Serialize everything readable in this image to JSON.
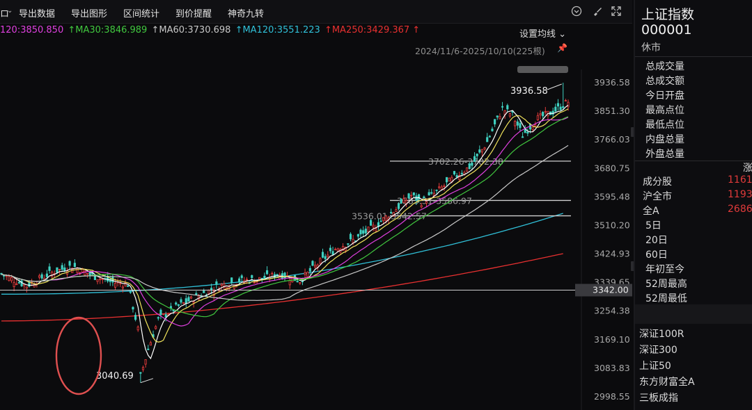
{
  "toolbar": {
    "first_item": "ロ",
    "items": [
      "导出数据",
      "导出图形",
      "区间统计",
      "到价提醒",
      "神奇九转"
    ],
    "icons": [
      "chevron-circle-icon",
      "brush-icon",
      "fullscreen-icon"
    ]
  },
  "ma_bar": {
    "ma20": "120:3850.850",
    "ma30": "↑MA30:3846.989",
    "ma60": "↑MA60:3730.698",
    "ma120": "↑MA120:3551.223",
    "ma250": "↑MA250:3429.367 ↑"
  },
  "colors": {
    "ma5": "#ffffff",
    "ma10": "#f2e55c",
    "ma20": "#e040e0",
    "ma30": "#41c83f",
    "ma60": "#c8c8c8",
    "ma120": "#30c0d8",
    "ma250": "#e83030",
    "up": "#e03a3a",
    "down": "#3fd0c0"
  },
  "setting_label": "设置均线",
  "range_label": "2024/11/6-2025/10/10(225根)",
  "chart_data": {
    "type": "candlestick",
    "y_axis_ticks": [
      "3936.58",
      "3851.30",
      "3766.03",
      "3680.75",
      "3595.48",
      "3510.20",
      "3424.93",
      "3339.65",
      "3254.38",
      "3169.10",
      "3083.83",
      "2998.55"
    ],
    "ylim": [
      2998.55,
      3936.58
    ],
    "current_price_tag": "3342.00",
    "high_label": "3936.58",
    "low_label": "3040.69",
    "gap_labels": [
      "3702.26-3702.38",
      "3583.31-3586.97",
      "3536.01-3542.57"
    ],
    "gap_levels": [
      3702.3,
      3585.0,
      3539.0
    ],
    "candle_count": 225,
    "series": [
      {
        "name": "MA20",
        "color_key": "ma20"
      },
      {
        "name": "MA30",
        "color_key": "ma30"
      },
      {
        "name": "MA60",
        "color_key": "ma60"
      },
      {
        "name": "MA120",
        "color_key": "ma120"
      },
      {
        "name": "MA250",
        "color_key": "ma250"
      }
    ],
    "close_path": [
      [
        0,
        3365
      ],
      [
        10,
        3330
      ],
      [
        20,
        3370
      ],
      [
        28,
        3390
      ],
      [
        36,
        3360
      ],
      [
        44,
        3340
      ],
      [
        50,
        3335
      ],
      [
        54,
        3200
      ],
      [
        55,
        3060
      ],
      [
        58,
        3140
      ],
      [
        62,
        3230
      ],
      [
        70,
        3270
      ],
      [
        78,
        3300
      ],
      [
        86,
        3330
      ],
      [
        94,
        3345
      ],
      [
        102,
        3350
      ],
      [
        110,
        3365
      ],
      [
        118,
        3345
      ],
      [
        125,
        3395
      ],
      [
        132,
        3440
      ],
      [
        140,
        3470
      ],
      [
        148,
        3510
      ],
      [
        156,
        3560
      ],
      [
        162,
        3600
      ],
      [
        166,
        3580
      ],
      [
        172,
        3610
      ],
      [
        180,
        3660
      ],
      [
        186,
        3690
      ],
      [
        192,
        3760
      ],
      [
        198,
        3860
      ],
      [
        202,
        3840
      ],
      [
        206,
        3780
      ],
      [
        212,
        3830
      ],
      [
        218,
        3850
      ],
      [
        224,
        3880
      ]
    ]
  },
  "panel": {
    "name": "上证指数",
    "code": "000001",
    "status": "休市",
    "stats": [
      "总成交量",
      "总成交额",
      "今日开盘",
      "最高点位",
      "最低点位",
      "内盘总量",
      "外盘总量"
    ],
    "change_header": "涨",
    "breadth": [
      {
        "label": "成分股",
        "value": "1161"
      },
      {
        "label": "沪全市",
        "value": "1193"
      },
      {
        "label": "全A",
        "value": "2686"
      }
    ],
    "periods": [
      "5日",
      "20日",
      "60日",
      "年初至今",
      "52周最高",
      "52周最低"
    ],
    "related": [
      "深证100R",
      "深证300",
      "上证50",
      "东方财富全A",
      "三板成指"
    ]
  }
}
